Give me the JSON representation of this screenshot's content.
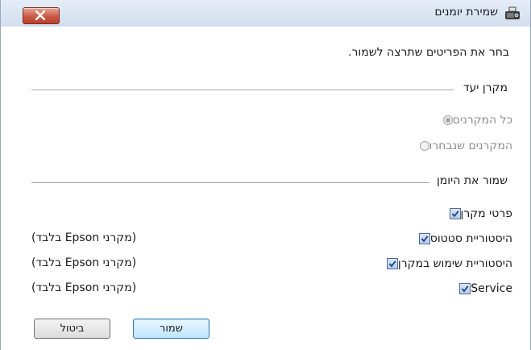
{
  "window": {
    "title": "שמירת יומנים",
    "icon": "projector-icon",
    "close_icon": "close-icon"
  },
  "intro": "בחר את הפריטים שתרצה לשמור.",
  "target_section": {
    "label": "מקרן יעד",
    "options": [
      {
        "label": "כל המקרנים",
        "checked": true,
        "disabled": true
      },
      {
        "label": "המקרנים שנבחרו",
        "checked": false,
        "disabled": true
      }
    ]
  },
  "save_section": {
    "label": "שמור את היומן",
    "items": [
      {
        "label": "פרטי מקרן",
        "checked": true,
        "note": ""
      },
      {
        "label": "היסטוריית סטטוס",
        "checked": true,
        "note": "(מקרני Epson בלבד)"
      },
      {
        "label": "היסטוריית שימוש במקרן",
        "checked": true,
        "note": "(מקרני Epson בלבד)"
      },
      {
        "label": "Service",
        "checked": true,
        "note": "(מקרני Epson בלבד)"
      }
    ]
  },
  "buttons": {
    "save": "שמור",
    "cancel": "ביטול"
  },
  "colors": {
    "title_bar": "#d8e3f2",
    "close_button": "#c85a45",
    "default_button_border": "#3c7fb1",
    "disabled_text": "#8c8c8c"
  }
}
